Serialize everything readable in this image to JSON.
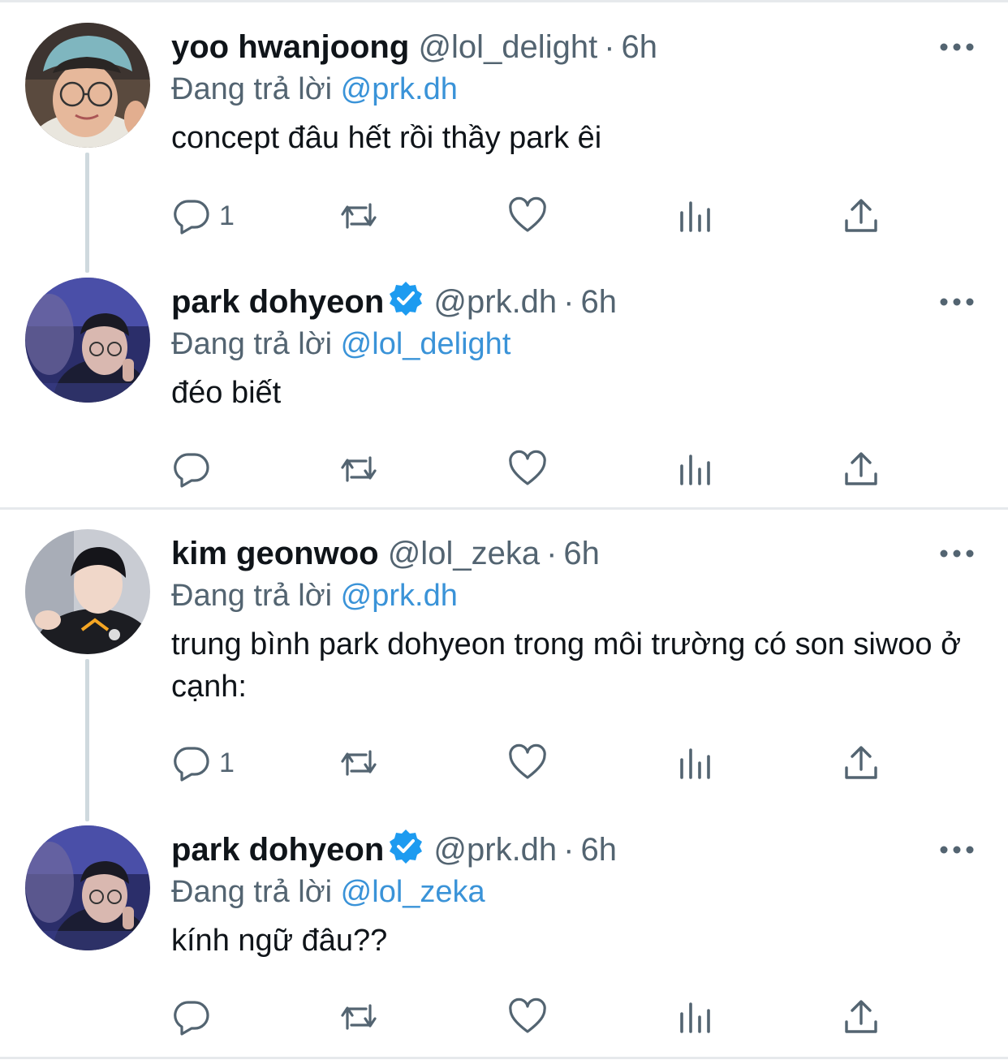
{
  "tweets": [
    {
      "name": "yoo hwanjoong",
      "verified": false,
      "handle": "@lol_delight",
      "dot": "·",
      "time": "6h",
      "reply_prefix": "Đang trả lời",
      "reply_to": "@prk.dh",
      "text": "concept đâu hết rồi thầy park êi",
      "reply_count": "1"
    },
    {
      "name": "park dohyeon",
      "verified": true,
      "handle": "@prk.dh",
      "dot": "·",
      "time": "6h",
      "reply_prefix": "Đang trả lời",
      "reply_to": "@lol_delight",
      "text": "đéo biết",
      "reply_count": ""
    },
    {
      "name": "kim geonwoo",
      "verified": false,
      "handle": "@lol_zeka",
      "dot": "·",
      "time": "6h",
      "reply_prefix": "Đang trả lời",
      "reply_to": "@prk.dh",
      "text": "trung bình park dohyeon trong môi trường có son siwoo ở cạnh:",
      "reply_count": "1"
    },
    {
      "name": "park dohyeon",
      "verified": true,
      "handle": "@prk.dh",
      "dot": "·",
      "time": "6h",
      "reply_prefix": "Đang trả lời",
      "reply_to": "@lol_zeka",
      "text": "kính ngữ đâu??",
      "reply_count": ""
    }
  ],
  "icons": {
    "reply": "speech-bubble-icon",
    "retweet": "retweet-icon",
    "like": "heart-icon",
    "analytics": "bar-chart-icon",
    "share": "share-upload-icon",
    "more": "more-dots-icon",
    "verified": "verified-badge-icon"
  },
  "colors": {
    "mention": "#3a93d8",
    "muted": "#536471",
    "verified": "#1d9bf0",
    "divider": "#e6e9ec",
    "thread_line": "#cfd9de"
  }
}
